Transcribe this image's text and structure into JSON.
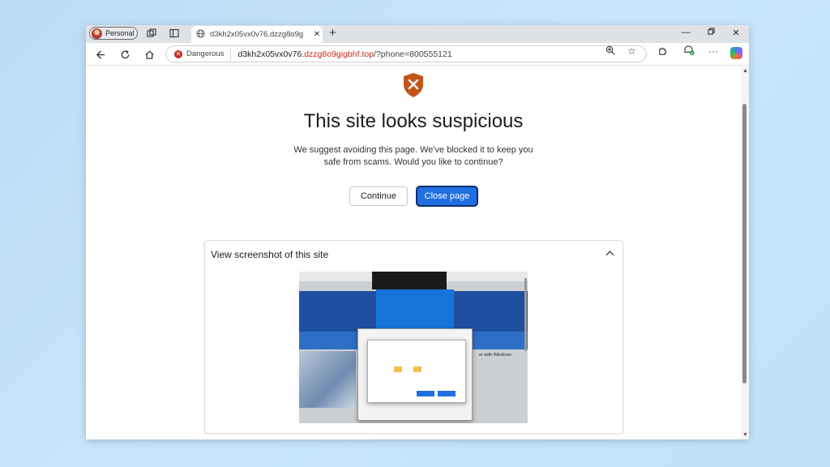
{
  "tabbar": {
    "profile_label": "Personal",
    "tab_title": "d3kh2x05vx0v76.dzzg8o9g"
  },
  "toolbar": {
    "danger_label": "Dangerous",
    "url_host": "d3kh2x05vx0v76.",
    "url_domain": "dzzg8o9gigbhf.top",
    "url_path": "/?phone=800555121"
  },
  "page": {
    "heading": "This site looks suspicious",
    "description": "We suggest avoiding this page. We've blocked it to keep you safe from scams. Would you like to continue?",
    "continue_label": "Continue",
    "close_label": "Close page",
    "panel_title": "View screenshot of this site"
  },
  "screenshot_preview": {
    "side_text": "er with Windows"
  },
  "colors": {
    "danger": "#c42b1c",
    "primary": "#1f6fe0",
    "shield": "#c2541a"
  }
}
